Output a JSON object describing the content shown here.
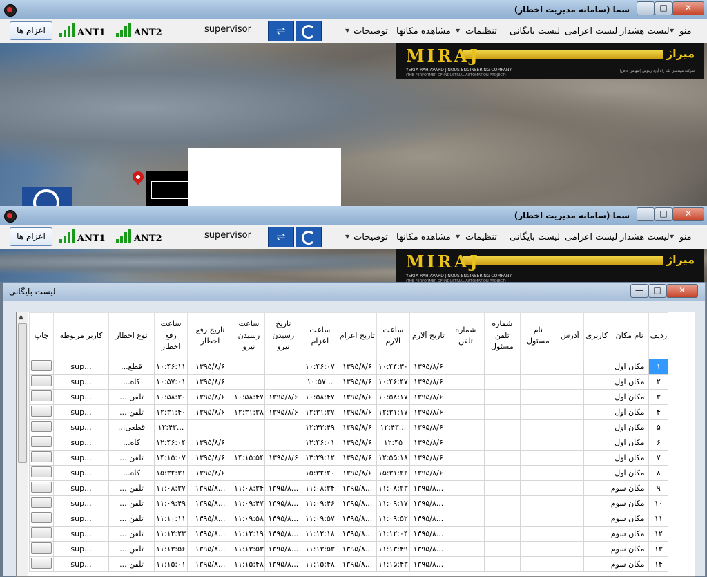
{
  "window": {
    "title": "سما (سامانه مدیریت اخطار)",
    "controls": {
      "minimize": "—",
      "maximize": "□",
      "close": "✕"
    }
  },
  "menubar": {
    "items": [
      "منو",
      "لیست هشدار",
      "لیست اعزامی",
      "لیست بایگانی",
      "تنظیمات",
      "مشاهده مکانها",
      "توضیحات"
    ],
    "alarm_button": "اعزام ها",
    "ant1": "ANT1",
    "ant2": "ANT2",
    "user": "supervisor",
    "usb_icon": "usb-icon",
    "refresh_icon": "refresh-icon"
  },
  "logo": {
    "word": "MIRAJ",
    "fa": "میراژ",
    "sub1": "YEKTA RAH AVARD JINOUS ENGINEERING COMPANY",
    "sub2": "(THE PERFORMER OF INDUSTRIAL AUTOMATION PROJECT)",
    "sub3": "شرکت مهندسی یکتا راه آورد ژینوس (سهامی خاص)"
  },
  "dialog": {
    "title": "لیست بایگانی",
    "controls": {
      "minimize": "—",
      "maximize": "□",
      "close": "✕"
    },
    "columns": [
      "ردیف",
      "نام مکان",
      "کاربری",
      "آدرس",
      "نام مسئول",
      "شماره تلفن مسئول",
      "شماره تلفن",
      "تاریخ آلارم",
      "ساعت آلارم",
      "تاریخ اعزام",
      "ساعت اعزام",
      "تاریخ رسیدن نیرو",
      "ساعت رسیدن نیرو",
      "تاریخ رفع اخطار",
      "ساعت رفع اخطار",
      "نوع اخطار",
      "کاربر مربوطه",
      "چاپ"
    ],
    "rows": [
      [
        "۱",
        "مکان اول",
        "",
        "",
        "",
        "",
        "",
        "۱۳۹۵/۸/۶",
        "۱۰:۴۴:۳۰",
        "۱۳۹۵/۸/۶",
        "۱۰:۴۶:۰۷",
        "",
        "",
        "۱۳۹۵/۸/۶",
        "۱۰:۴۶:۱۱",
        "قطع...",
        "...sup"
      ],
      [
        "۲",
        "مکان اول",
        "",
        "",
        "",
        "",
        "",
        "۱۳۹۵/۸/۶",
        "۱۰:۴۶:۴۷",
        "۱۳۹۵/۸/۶",
        "...۱۰:۵۷",
        "",
        "",
        "۱۳۹۵/۸/۶",
        "۱۰:۵۷:۰۱",
        "کاه...",
        "...sup"
      ],
      [
        "۳",
        "مکان اول",
        "",
        "",
        "",
        "",
        "",
        "۱۳۹۵/۸/۶",
        "۱۰:۵۸:۱۷",
        "۱۳۹۵/۸/۶",
        "۱۰:۵۸:۴۷",
        "۱۳۹۵/۸/۶",
        "۱۰:۵۸:۴۷",
        "۱۳۹۵/۸/۶",
        "۱۰:۵۸:۳۰",
        "تلفن ...",
        "...sup"
      ],
      [
        "۴",
        "مکان اول",
        "",
        "",
        "",
        "",
        "",
        "۱۳۹۵/۸/۶",
        "۱۲:۳۱:۱۷",
        "۱۳۹۵/۸/۶",
        "۱۲:۳۱:۳۷",
        "۱۳۹۵/۸/۶",
        "۱۲:۳۱:۳۸",
        "۱۳۹۵/۸/۶",
        "۱۲:۳۱:۴۰",
        "تلفن ...",
        "...sup"
      ],
      [
        "۵",
        "مکان اول",
        "",
        "",
        "",
        "",
        "",
        "۱۳۹۵/۸/۶",
        "...۱۲:۴۳",
        "۱۳۹۵/۸/۶",
        "۱۲:۴۳:۴۹",
        "",
        "",
        "",
        "...۱۲:۴۳",
        "قطعی...",
        "...sup"
      ],
      [
        "۶",
        "مکان اول",
        "",
        "",
        "",
        "",
        "",
        "۱۳۹۵/۸/۶",
        "۱۲:۴۵",
        "۱۳۹۵/۸/۶",
        "۱۲:۴۶:۰۱",
        "",
        "",
        "۱۳۹۵/۸/۶",
        "۱۲:۴۶:۰۴",
        "کاه...",
        "...sup"
      ],
      [
        "۷",
        "مکان اول",
        "",
        "",
        "",
        "",
        "",
        "۱۳۹۵/۸/۶",
        "۱۲:۵۵:۱۸",
        "۱۳۹۵/۸/۶",
        "۱۳:۲۹:۱۲",
        "۱۳۹۵/۸/۶",
        "۱۴:۱۵:۵۴",
        "۱۳۹۵/۸/۶",
        "۱۴:۱۵:۰۷",
        "تلفن ...",
        "...sup"
      ],
      [
        "۸",
        "مکان اول",
        "",
        "",
        "",
        "",
        "",
        "۱۳۹۵/۸/۶",
        "۱۵:۳۱:۲۲",
        "۱۳۹۵/۸/۶",
        "۱۵:۳۲:۲۰",
        "",
        "",
        "۱۳۹۵/۸/۶",
        "۱۵:۳۲:۳۱",
        "کاه...",
        "...sup"
      ],
      [
        "۹",
        "مکان سوم",
        "",
        "",
        "",
        "",
        "",
        "...۱۳۹۵/۸",
        "۱۱:۰۸:۲۳",
        "...۱۳۹۵/۸",
        "۱۱:۰۸:۳۴",
        "...۱۳۹۵/۸",
        "۱۱:۰۸:۳۴",
        "...۱۳۹۵/۸",
        "۱۱:۰۸:۳۷",
        "تلفن ...",
        "...sup"
      ],
      [
        "۱۰",
        "مکان سوم",
        "",
        "",
        "",
        "",
        "",
        "...۱۳۹۵/۸",
        "۱۱:۰۹:۱۷",
        "...۱۳۹۵/۸",
        "۱۱:۰۹:۴۶",
        "...۱۳۹۵/۸",
        "۱۱:۰۹:۴۷",
        "...۱۳۹۵/۸",
        "۱۱:۰۹:۴۹",
        "تلفن ...",
        "...sup"
      ],
      [
        "۱۱",
        "مکان سوم",
        "",
        "",
        "",
        "",
        "",
        "...۱۳۹۵/۸",
        "۱۱:۰۹:۵۲",
        "...۱۳۹۵/۸",
        "۱۱:۰۹:۵۷",
        "...۱۳۹۵/۸",
        "۱۱:۰۹:۵۸",
        "...۱۳۹۵/۸",
        "۱۱:۱۰:۱۱",
        "تلفن ...",
        "...sup"
      ],
      [
        "۱۲",
        "مکان سوم",
        "",
        "",
        "",
        "",
        "",
        "...۱۳۹۵/۸",
        "۱۱:۱۲:۰۴",
        "...۱۳۹۵/۸",
        "۱۱:۱۲:۱۸",
        "...۱۳۹۵/۸",
        "۱۱:۱۲:۱۹",
        "...۱۳۹۵/۸",
        "۱۱:۱۲:۲۳",
        "تلفن ...",
        "...sup"
      ],
      [
        "۱۳",
        "مکان سوم",
        "",
        "",
        "",
        "",
        "",
        "...۱۳۹۵/۸",
        "۱۱:۱۳:۴۹",
        "...۱۳۹۵/۸",
        "۱۱:۱۳:۵۳",
        "...۱۳۹۵/۸",
        "۱۱:۱۳:۵۳",
        "...۱۳۹۵/۸",
        "۱۱:۱۳:۵۶",
        "تلفن ...",
        "...sup"
      ],
      [
        "۱۴",
        "مکان سوم",
        "",
        "",
        "",
        "",
        "",
        "...۱۳۹۵/۸",
        "۱۱:۱۵:۴۳",
        "...۱۳۹۵/۸",
        "۱۱:۱۵:۴۸",
        "...۱۳۹۵/۸",
        "۱۱:۱۵:۴۸",
        "...۱۳۹۵/۸",
        "۱۱:۱۵:۰۱",
        "تلفن ...",
        "...sup"
      ]
    ]
  }
}
